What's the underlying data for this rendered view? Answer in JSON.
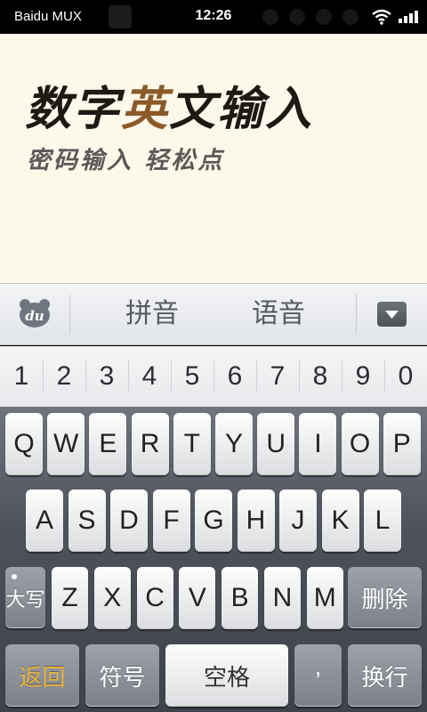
{
  "status_bar": {
    "carrier": "Baidu MUX",
    "time": "12:26"
  },
  "content": {
    "title_part1": "数字",
    "title_highlight": "英",
    "title_part2": "文输入",
    "subtitle": "密码输入  轻松点"
  },
  "toolbar": {
    "logo_text": "du",
    "pinyin_label": "拼音",
    "voice_label": "语音"
  },
  "number_row": [
    "1",
    "2",
    "3",
    "4",
    "5",
    "6",
    "7",
    "8",
    "9",
    "0"
  ],
  "keyboard": {
    "row1": [
      "Q",
      "W",
      "E",
      "R",
      "T",
      "Y",
      "U",
      "I",
      "O",
      "P"
    ],
    "row2": [
      "A",
      "S",
      "D",
      "F",
      "G",
      "H",
      "J",
      "K",
      "L"
    ],
    "row3": [
      "Z",
      "X",
      "C",
      "V",
      "B",
      "N",
      "M"
    ],
    "shift_label": "大写",
    "delete_label": "删除",
    "back_label": "返回",
    "symbol_label": "符号",
    "space_label": "空格",
    "comma_label": ",",
    "enter_label": "换行"
  },
  "colors": {
    "content_bg": "#fdf9ea",
    "back_text": "#e9b23a",
    "title_highlight": "#8a5a28"
  }
}
